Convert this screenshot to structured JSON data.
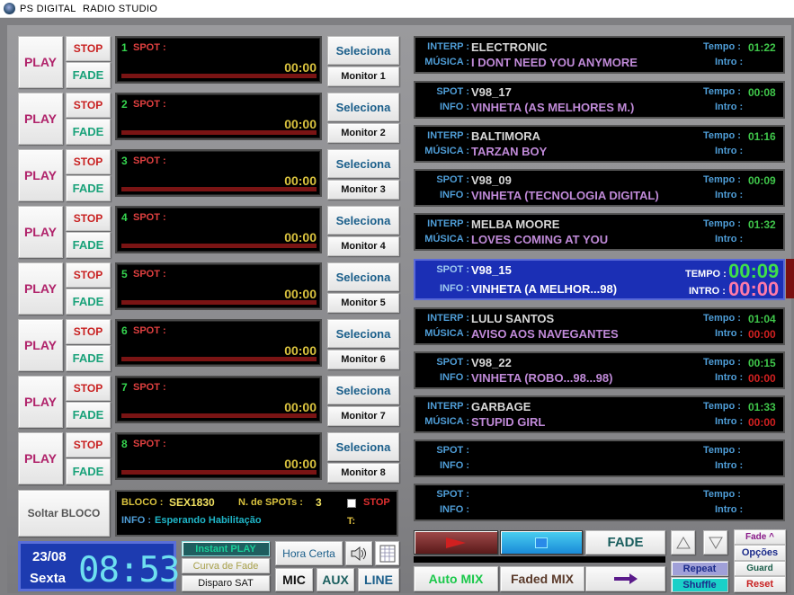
{
  "window": {
    "title": "PS DIGITAL",
    "subtitle": "RADIO  STUDIO"
  },
  "spots": [
    {
      "play": "PLAY",
      "stop": "STOP",
      "fade": "FADE",
      "num": "1",
      "label": "SPOT :",
      "time": "00:00",
      "select": "Seleciona",
      "monitor": "Monitor 1"
    },
    {
      "play": "PLAY",
      "stop": "STOP",
      "fade": "FADE",
      "num": "2",
      "label": "SPOT :",
      "time": "00:00",
      "select": "Seleciona",
      "monitor": "Monitor 2"
    },
    {
      "play": "PLAY",
      "stop": "STOP",
      "fade": "FADE",
      "num": "3",
      "label": "SPOT :",
      "time": "00:00",
      "select": "Seleciona",
      "monitor": "Monitor 3"
    },
    {
      "play": "PLAY",
      "stop": "STOP",
      "fade": "FADE",
      "num": "4",
      "label": "SPOT :",
      "time": "00:00",
      "select": "Seleciona",
      "monitor": "Monitor 4"
    },
    {
      "play": "PLAY",
      "stop": "STOP",
      "fade": "FADE",
      "num": "5",
      "label": "SPOT :",
      "time": "00:00",
      "select": "Seleciona",
      "monitor": "Monitor 5"
    },
    {
      "play": "PLAY",
      "stop": "STOP",
      "fade": "FADE",
      "num": "6",
      "label": "SPOT :",
      "time": "00:00",
      "select": "Seleciona",
      "monitor": "Monitor 6"
    },
    {
      "play": "PLAY",
      "stop": "STOP",
      "fade": "FADE",
      "num": "7",
      "label": "SPOT :",
      "time": "00:00",
      "select": "Seleciona",
      "monitor": "Monitor 7"
    },
    {
      "play": "PLAY",
      "stop": "STOP",
      "fade": "FADE",
      "num": "8",
      "label": "SPOT :",
      "time": "00:00",
      "select": "Seleciona",
      "monitor": "Monitor 8"
    }
  ],
  "bloco": {
    "release": "Soltar BLOCO",
    "bloco_label": "BLOCO :",
    "bloco_value": "SEX1830",
    "nspots_label": "N. de SPOTs :",
    "nspots_value": "3",
    "stop": "STOP",
    "info_label": "INFO :",
    "info_value": "Esperando Habilitação",
    "t_label": "T:"
  },
  "clock": {
    "date": "23/08",
    "day": "Sexta",
    "time": "08:53"
  },
  "controls": {
    "instant_play": "Instant  PLAY",
    "curva": "Curva de Fade",
    "disparo": "Disparo SAT",
    "hora_certa": "Hora Certa",
    "mic": "MIC",
    "aux": "AUX",
    "line": "LINE"
  },
  "playlist": [
    {
      "l1": "INTERP :",
      "v1": "ELECTRONIC",
      "l2": "MÚSICA :",
      "v2": "I DONT NEED YOU ANYMORE",
      "tempo_label": "Tempo :",
      "tempo": "01:22",
      "intro_label": "Intro :",
      "intro": ""
    },
    {
      "l1": "SPOT :",
      "v1": "V98_17",
      "l2": "INFO :",
      "v2": "VINHETA (AS MELHORES M.)",
      "tempo_label": "Tempo :",
      "tempo": "00:08",
      "intro_label": "Intro :",
      "intro": ""
    },
    {
      "l1": "INTERP :",
      "v1": "BALTIMORA",
      "l2": "MÚSICA :",
      "v2": "TARZAN BOY",
      "tempo_label": "Tempo :",
      "tempo": "01:16",
      "intro_label": "Intro :",
      "intro": ""
    },
    {
      "l1": "SPOT :",
      "v1": "V98_09",
      "l2": "INFO :",
      "v2": "VINHETA (TECNOLOGIA DIGITAL)",
      "tempo_label": "Tempo :",
      "tempo": "00:09",
      "intro_label": "Intro :",
      "intro": ""
    },
    {
      "l1": "INTERP :",
      "v1": "MELBA MOORE",
      "l2": "MÚSICA :",
      "v2": "LOVES COMING AT YOU",
      "tempo_label": "Tempo :",
      "tempo": "01:32",
      "intro_label": "Intro :",
      "intro": ""
    },
    {
      "l1": "SPOT :",
      "v1": "V98_15",
      "l2": "INFO :",
      "v2": "VINHETA (A MELHOR...98)",
      "tempo_label": "TEMPO :",
      "tempo": "00:09",
      "intro_label": "INTRO :",
      "intro": "00:00",
      "active": true
    },
    {
      "l1": "INTERP :",
      "v1": "LULU SANTOS",
      "l2": "MÚSICA :",
      "v2": "AVISO AOS NAVEGANTES",
      "tempo_label": "Tempo :",
      "tempo": "01:04",
      "intro_label": "Intro :",
      "intro": "00:00"
    },
    {
      "l1": "SPOT :",
      "v1": "V98_22",
      "l2": "INFO :",
      "v2": "VINHETA (ROBO...98...98)",
      "tempo_label": "Tempo :",
      "tempo": "00:15",
      "intro_label": "Intro :",
      "intro": "00:00"
    },
    {
      "l1": "INTERP :",
      "v1": "GARBAGE",
      "l2": "MÚSICA :",
      "v2": "STUPID GIRL",
      "tempo_label": "Tempo :",
      "tempo": "01:33",
      "intro_label": "Intro :",
      "intro": "00:00"
    },
    {
      "l1": "SPOT :",
      "v1": "",
      "l2": "INFO :",
      "v2": "",
      "tempo_label": "Tempo :",
      "tempo": "",
      "intro_label": "Intro :",
      "intro": ""
    },
    {
      "l1": "SPOT :",
      "v1": "",
      "l2": "INFO :",
      "v2": "",
      "tempo_label": "Tempo :",
      "tempo": "",
      "intro_label": "Intro :",
      "intro": ""
    }
  ],
  "transport": {
    "fade": "FADE",
    "auto_mix": "Auto MIX",
    "faded_mix": "Faded MIX",
    "repeat": "Repeat",
    "shuffle": "Shuffle",
    "fade_up": "Fade ^",
    "opcoes": "Opções",
    "guard": "Guard",
    "reset": "Reset"
  },
  "colors": {
    "accent_green": "#3fc64a",
    "active_blue": "#1b2fb5",
    "clock_blue": "#1d3bb0"
  }
}
